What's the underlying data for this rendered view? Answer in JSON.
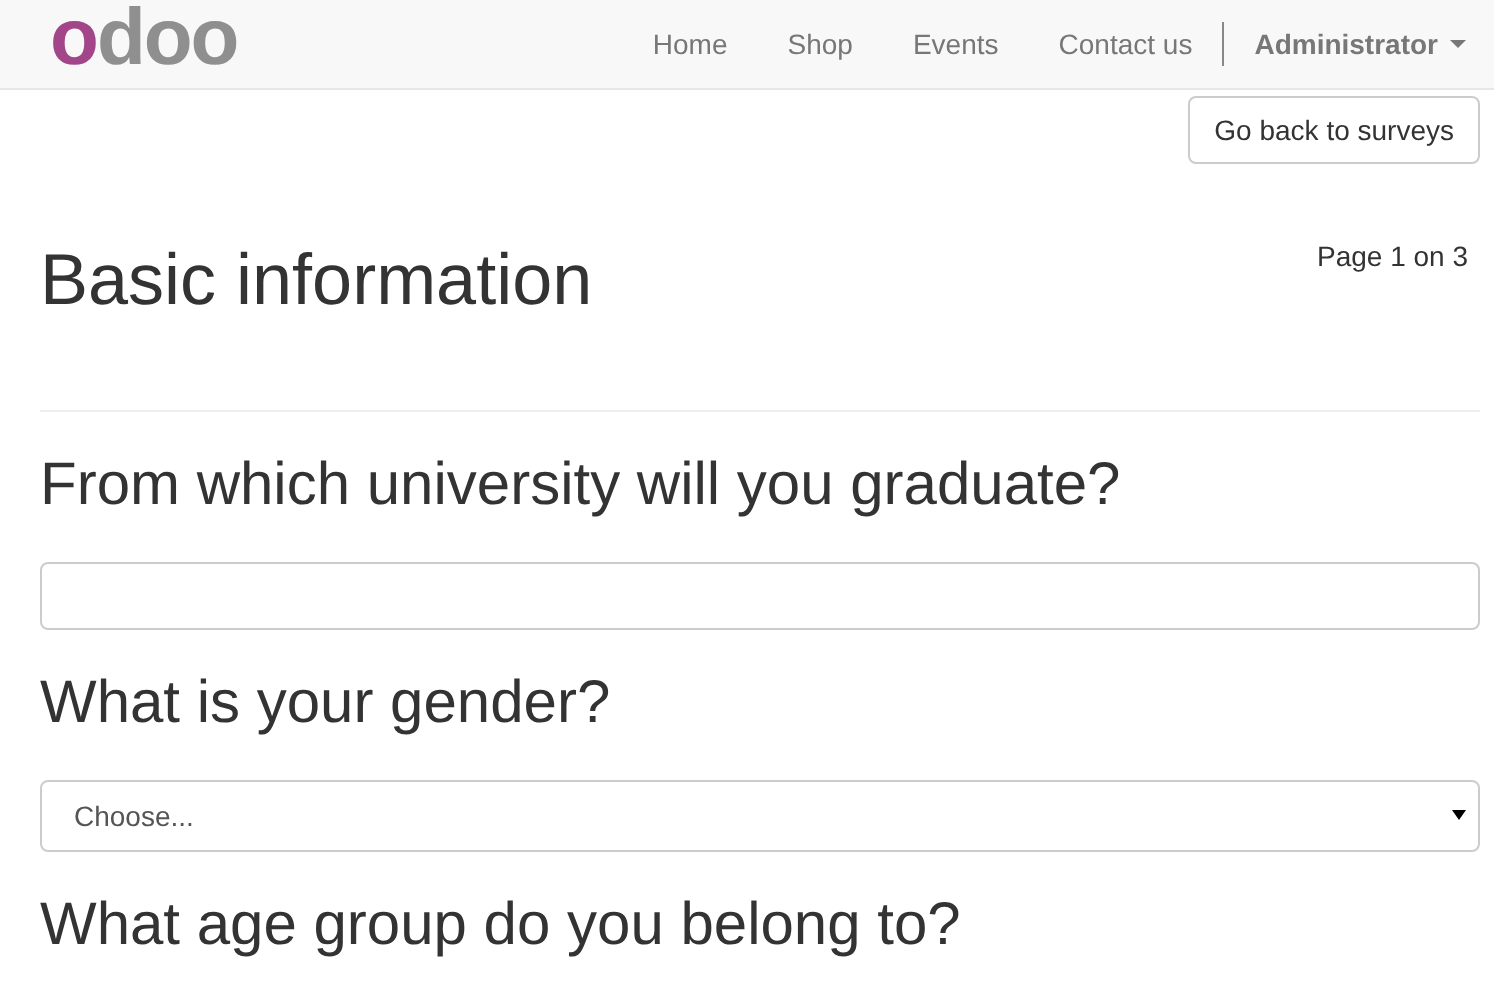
{
  "navbar": {
    "brand": "odoo",
    "links": [
      {
        "label": "Home"
      },
      {
        "label": "Shop"
      },
      {
        "label": "Events"
      },
      {
        "label": "Contact us"
      }
    ],
    "user": "Administrator"
  },
  "back_button": "Go back to surveys",
  "page": {
    "title": "Basic information",
    "pager": "Page 1 on 3"
  },
  "questions": [
    {
      "title": "From which university will you graduate?",
      "answer": {
        "kind": "text"
      }
    },
    {
      "title": "What is your gender?",
      "answer": {
        "kind": "select",
        "value": "Choose..."
      }
    },
    {
      "title": "What age group do you belong to?"
    }
  ]
}
